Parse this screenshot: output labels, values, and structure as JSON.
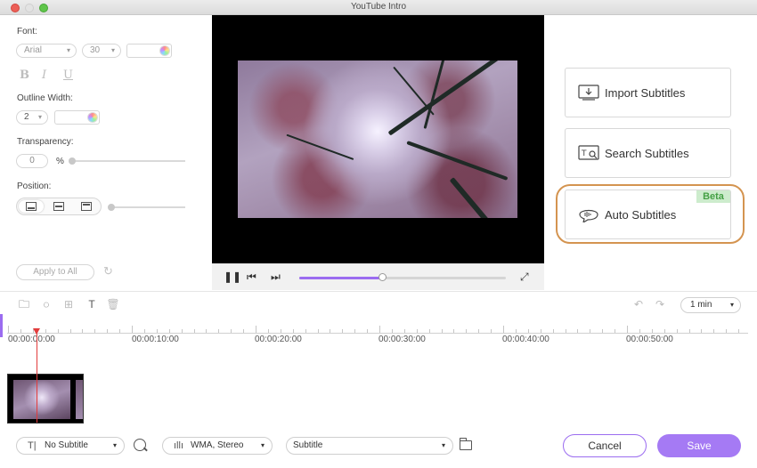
{
  "window": {
    "title": "YouTube Intro"
  },
  "style_panel": {
    "font_label": "Font:",
    "font_family": "Arial",
    "font_size": "30",
    "bold": "B",
    "italic": "I",
    "underline": "U",
    "outline_label": "Outline Width:",
    "outline_width": "2",
    "transparency_label": "Transparency:",
    "transparency_value": "0",
    "transparency_unit": "%",
    "position_label": "Position:",
    "apply_all": "Apply to All"
  },
  "player": {
    "progress_fraction": 0.4
  },
  "subtitle_options": {
    "import": "Import Subtitles",
    "search": "Search Subtitles",
    "auto": "Auto Subtitles",
    "beta": "Beta"
  },
  "toolbar": {
    "zoom": "1 min"
  },
  "timeline": {
    "labels": [
      "00:00:00:00",
      "00:00:10:00",
      "00:00:20:00",
      "00:00:30:00",
      "00:00:40:00",
      "00:00:50:00"
    ]
  },
  "bottom_bar": {
    "subtitle_select": "No Subtitle",
    "audio_select": "WMA, Stereo",
    "track_select": "Subtitle",
    "cancel": "Cancel",
    "save": "Save"
  },
  "colors": {
    "accent": "#a57af4",
    "highlight_outline": "#d49450",
    "beta_bg": "#cdeccd",
    "playhead": "#e23c3c"
  }
}
